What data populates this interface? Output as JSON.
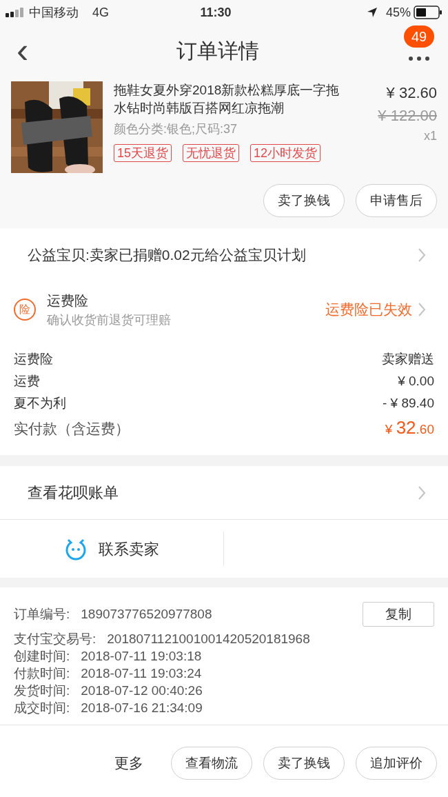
{
  "status_bar": {
    "carrier": "中国移动",
    "network": "4G",
    "time": "11:30",
    "battery": "45%"
  },
  "header": {
    "back": "‹",
    "title": "订单详情",
    "more_badge": "49"
  },
  "product": {
    "title": "拖鞋女夏外穿2018新款松糕厚底一字拖水钻时尚韩版百搭网红凉拖潮",
    "sku": "颜色分类:银色;尺码:37",
    "price": "¥ 32.60",
    "original_price": "¥ 122.00",
    "quantity": "x1",
    "tags": [
      "15天退货",
      "无忧退货",
      "12小时发货"
    ],
    "buttons": [
      "卖了换钱",
      "申请售后"
    ]
  },
  "charity": {
    "text": "公益宝贝:卖家已捐赠0.02元给公益宝贝计划"
  },
  "insurance": {
    "icon": "险",
    "title": "运费险",
    "subtitle": "确认收货前退货可理赔",
    "status": "运费险已失效"
  },
  "fees": [
    {
      "label": "运费险",
      "value": "卖家赠送"
    },
    {
      "label": "运费",
      "value": "¥ 0.00"
    },
    {
      "label": "夏不为利",
      "value": "- ¥ 89.40"
    }
  ],
  "total": {
    "label": "实付款（含运费）",
    "currency": "¥ ",
    "integer": "32",
    "decimal": ".60"
  },
  "huabei": {
    "text": "查看花呗账单"
  },
  "contact": {
    "text": "联系卖家"
  },
  "order_info": {
    "copy_button": "复制",
    "rows": [
      {
        "label": "订单编号:",
        "value": "189073776520977808"
      },
      {
        "label": "支付宝交易号:",
        "value": "2018071121001001420520181968"
      },
      {
        "label": "创建时间:",
        "value": "2018-07-11 19:03:18"
      },
      {
        "label": "付款时间:",
        "value": "2018-07-11 19:03:24"
      },
      {
        "label": "发货时间:",
        "value": "2018-07-12 00:40:26"
      },
      {
        "label": "成交时间:",
        "value": "2018-07-16 21:34:09"
      }
    ]
  },
  "footer": {
    "more": "更多",
    "buttons": [
      "查看物流",
      "卖了换钱",
      "追加评价"
    ]
  }
}
